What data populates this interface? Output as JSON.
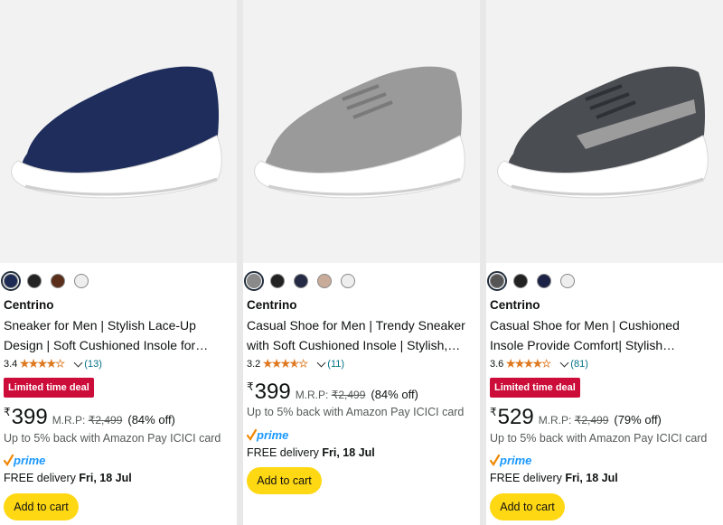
{
  "products": [
    {
      "brand": "Centrino",
      "title_line1": "Sneaker for Men | Stylish Lace-Up",
      "title_line2": "Design | Soft Cushioned Insole for…",
      "rating": "3.4",
      "rating_value": 3.4,
      "review_count": "(13)",
      "deal_badge": "Limited time deal",
      "currency": "₹",
      "price": "399",
      "mrp_label": "M.R.P:",
      "mrp": "₹2,499",
      "discount": "(84% off)",
      "cashback": "Up to 5% back with Amazon Pay ICICI card",
      "prime": "prime",
      "delivery_label": "FREE delivery",
      "delivery_date": "Fri, 18 Jul",
      "add_to_cart": "Add to cart",
      "swatches": [
        "#1c2a54",
        "#222222",
        "#5a2e1a",
        "#eeeeee"
      ],
      "selected_swatch": 0,
      "shoe_color": "#1e2d5c"
    },
    {
      "brand": "Centrino",
      "title_line1": "Casual Shoe for Men | Trendy Sneaker",
      "title_line2": "with Soft Cushioned Insole | Stylish,…",
      "rating": "3.2",
      "rating_value": 3.2,
      "review_count": "(11)",
      "deal_badge": "",
      "currency": "₹",
      "price": "399",
      "mrp_label": "M.R.P:",
      "mrp": "₹2,499",
      "discount": "(84% off)",
      "cashback": "Up to 5% back with Amazon Pay ICICI card",
      "prime": "prime",
      "delivery_label": "FREE delivery",
      "delivery_date": "Fri, 18 Jul",
      "add_to_cart": "Add to cart",
      "swatches": [
        "#8a8a8a",
        "#222222",
        "#252b45",
        "#c9ab9a",
        "#eeeeee"
      ],
      "selected_swatch": 0,
      "shoe_color": "#9a9a9a"
    },
    {
      "brand": "Centrino",
      "title_line1": "Casual Shoe for Men | Cushioned",
      "title_line2": "Insole Provide Comfort| Stylish…",
      "rating": "3.6",
      "rating_value": 3.6,
      "review_count": "(81)",
      "deal_badge": "Limited time deal",
      "currency": "₹",
      "price": "529",
      "mrp_label": "M.R.P:",
      "mrp": "₹2,499",
      "discount": "(79% off)",
      "cashback": "Up to 5% back with Amazon Pay ICICI card",
      "prime": "prime",
      "delivery_label": "FREE delivery",
      "delivery_date": "Fri, 18 Jul",
      "add_to_cart": "Add to cart",
      "swatches": [
        "#555555",
        "#222222",
        "#1c2346",
        "#eeeeee"
      ],
      "selected_swatch": 0,
      "shoe_color": "#4a4d52"
    }
  ],
  "colors": {
    "deal": "#cc0c39",
    "button": "#ffd814",
    "star": "#de7921",
    "link": "#007185"
  }
}
